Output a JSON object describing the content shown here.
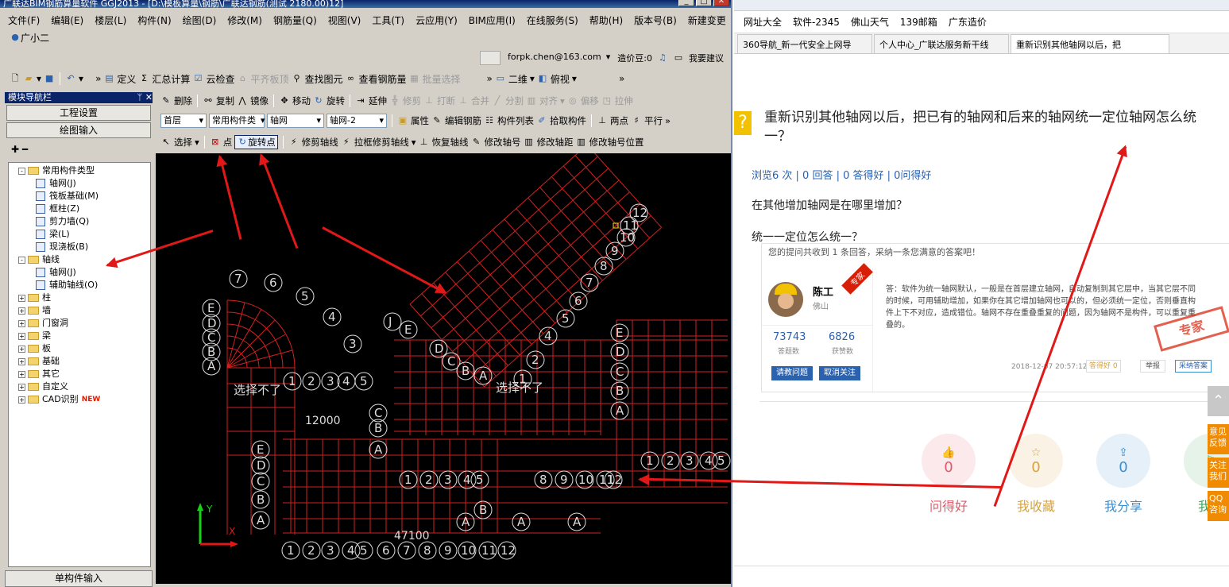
{
  "app": {
    "title": "广联达BIM钢筋算量软件 GGJ2013 - [D:\\模板算量\\钢筋\\广联达钢筋(测试 2180.00)12]"
  },
  "menu": [
    "文件(F)",
    "编辑(E)",
    "楼层(L)",
    "构件(N)",
    "绘图(D)",
    "修改(M)",
    "钢筋量(Q)",
    "视图(V)",
    "工具(T)",
    "云应用(Y)",
    "BIM应用(I)",
    "在线服务(S)",
    "帮助(H)",
    "版本号(B)",
    "新建变更"
  ],
  "assistant": "广小二",
  "account": {
    "email": "forpk.chen@163.com",
    "credit": "造价豆:0",
    "suggest": "我要建议"
  },
  "toolbar1": {
    "define": "定义",
    "sum": "汇总计算",
    "cloud": "云检查",
    "flush": "平齐板顶",
    "find": "查找图元",
    "view_rebar": "查看钢筋量",
    "batch": "批量选择",
    "twod": "二维",
    "view": "俯视"
  },
  "toolbar2": {
    "delete": "删除",
    "copy": "复制",
    "mirror": "镜像",
    "move": "移动",
    "rotate": "旋转",
    "extend": "延伸",
    "trim": "修剪",
    "break": "打断",
    "merge": "合并",
    "split": "分割",
    "align": "对齐",
    "offset": "偏移",
    "stretch": "拉伸"
  },
  "toolbar3": {
    "floor": "首层",
    "type": "常用构件类",
    "cat": "轴网",
    "name": "轴网-2",
    "prop": "属性",
    "edit_rebar": "编辑钢筋",
    "list": "构件列表",
    "pick": "拾取构件",
    "twopt": "两点",
    "parallel": "平行"
  },
  "toolbar4": {
    "select": "选择",
    "point": "点",
    "rotpt": "旋转点",
    "trim_axis": "修剪轴线",
    "box_trim": "拉框修剪轴线",
    "restore": "恢复轴线",
    "edit_no": "修改轴号",
    "edit_dist": "修改轴距",
    "edit_pos": "修改轴号位置"
  },
  "nav": {
    "title": "模块导航栏",
    "setup": "工程设置",
    "draw": "绘图输入",
    "single": "单构件输入"
  },
  "tree": [
    {
      "label": "常用构件类型",
      "level": 0,
      "exp": "-"
    },
    {
      "label": "轴网(J)",
      "level": 1,
      "leaf": true
    },
    {
      "label": "筏板基础(M)",
      "level": 1,
      "leaf": true
    },
    {
      "label": "框柱(Z)",
      "level": 1,
      "leaf": true
    },
    {
      "label": "剪力墙(Q)",
      "level": 1,
      "leaf": true
    },
    {
      "label": "梁(L)",
      "level": 1,
      "leaf": true
    },
    {
      "label": "现浇板(B)",
      "level": 1,
      "leaf": true
    },
    {
      "label": "轴线",
      "level": 0,
      "exp": "-"
    },
    {
      "label": "轴网(J)",
      "level": 1,
      "leaf": true
    },
    {
      "label": "辅助轴线(O)",
      "level": 1,
      "leaf": true
    },
    {
      "label": "柱",
      "level": 0,
      "exp": "+"
    },
    {
      "label": "墙",
      "level": 0,
      "exp": "+"
    },
    {
      "label": "门窗洞",
      "level": 0,
      "exp": "+"
    },
    {
      "label": "梁",
      "level": 0,
      "exp": "+"
    },
    {
      "label": "板",
      "level": 0,
      "exp": "+"
    },
    {
      "label": "基础",
      "level": 0,
      "exp": "+"
    },
    {
      "label": "其它",
      "level": 0,
      "exp": "+"
    },
    {
      "label": "自定义",
      "level": 0,
      "exp": "+"
    },
    {
      "label": "CAD识别",
      "level": 0,
      "exp": "+",
      "badge": "NEW"
    }
  ],
  "canvas": {
    "note1": "选择不了",
    "note2": "选择不了",
    "ucs_x": "X",
    "ucs_y": "Y",
    "dim1": "12000",
    "dim2": "47100"
  },
  "browser": {
    "bookmarks": [
      "网址大全",
      "软件-2345",
      "佛山天气",
      "139邮箱",
      "广东造价"
    ],
    "tabs": [
      "360导航_新一代安全上网导",
      "个人中心_广联达服务新干线",
      "重新识别其他轴网以后，把"
    ]
  },
  "question": {
    "title": "重新识别其他轴网以后，把已有的轴网和后来的轴网统一定位轴网怎么统一？",
    "stats": "浏览6 次 | 0 回答 | 0 答得好 | 0问得好",
    "q1": "在其他增加轴网是在哪里增加？",
    "q2": "统一一定位怎么统一？"
  },
  "answer": {
    "header": "您的提问共收到 1 条回答，采纳一条您满意的答案吧！",
    "name": "陈工",
    "city": "佛山",
    "badge": "专家",
    "stat1": "73743",
    "stat1_label": "答题数",
    "stat2": "6826",
    "stat2_label": "获赞数",
    "btn_ask": "请教问题",
    "btn_unfollow": "取消关注",
    "text": "答：软件为统一轴网默认，一般是在首层建立轴网，自动复制到其它层中，当其它层不同的时候，可用辅助增加，如果你在其它增加轴网也可以的，但必须统一定位，否则垂直构件上下不对应，造成错位。轴网不存在重叠重复的问题，因为轴网不是构件，可以重复重叠的。",
    "time": "2018-12-07 20:57:12",
    "good": "答得好 0",
    "report": "举报",
    "accept": "采纳答案",
    "stamp": "专家"
  },
  "actions": [
    {
      "label": "问得好",
      "count": "0",
      "color": "#e05a6a"
    },
    {
      "label": "我收藏",
      "count": "0",
      "color": "#d7a33a"
    },
    {
      "label": "我分享",
      "count": "0",
      "color": "#3a8fd0"
    },
    {
      "label": "我关",
      "count": "",
      "color": "#3aa85c"
    }
  ],
  "side": [
    "意见反馈",
    "关注我们",
    "QQ咨询"
  ],
  "colors": {
    "accent": "#0a246a",
    "red": "#e01818",
    "link": "#2a62b0"
  }
}
